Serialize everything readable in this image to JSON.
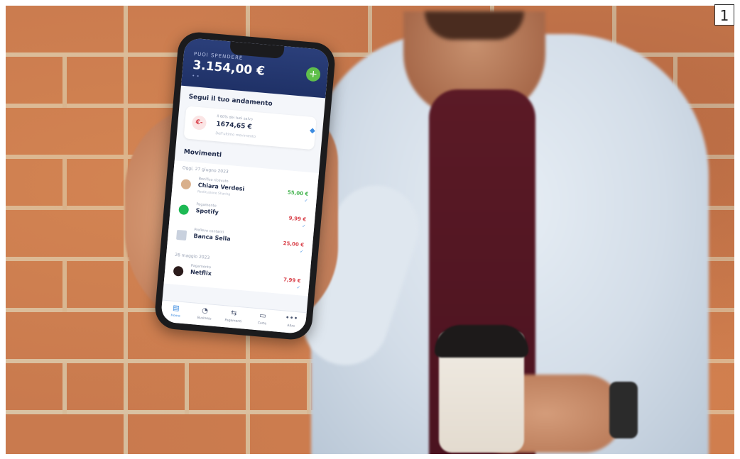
{
  "figure_number": "1",
  "phone": {
    "header": {
      "label": "PUOI SPENDERE",
      "balance": "3.154,00 €",
      "add_symbol": "+"
    },
    "trend": {
      "title": "Segui il tuo andamento",
      "icon_text": "€-",
      "subtitle": "Il 60% dei tuoi salvo",
      "value": "1674,65 €",
      "subtitle2": "Dell'ultimo movimento"
    },
    "movements": {
      "title": "Movimenti",
      "groups": [
        {
          "date": "Oggi, 27 giugno 2023",
          "items": [
            {
              "category": "Bonifico ricevuto",
              "name": "Chiara Verdesi",
              "note": "Restituzione Sharing",
              "amount": "55,00 €",
              "amount_color": "#3fb24a"
            },
            {
              "category": "Pagamento",
              "name": "Spotify",
              "note": "",
              "amount": "9,99 €",
              "amount_color": "#d9414a"
            },
            {
              "category": "Prelievo contanti",
              "name": "Banca Sella",
              "note": "",
              "amount": "25,00 €",
              "amount_color": "#d9414a"
            }
          ]
        },
        {
          "date": "26 maggio 2023",
          "items": [
            {
              "category": "Pagamento",
              "name": "Netflix",
              "note": "",
              "amount": "7,99 €",
              "amount_color": "#d9414a"
            }
          ]
        }
      ]
    },
    "nav": [
      {
        "label": "Home",
        "icon": "home-icon",
        "glyph": "▤"
      },
      {
        "label": "Business",
        "icon": "business-icon",
        "glyph": "◔"
      },
      {
        "label": "Pagamenti",
        "icon": "payments-icon",
        "glyph": "⇆"
      },
      {
        "label": "Carte",
        "icon": "card-icon",
        "glyph": "▭"
      },
      {
        "label": "Altro",
        "icon": "more-icon",
        "glyph": "•••"
      }
    ]
  }
}
